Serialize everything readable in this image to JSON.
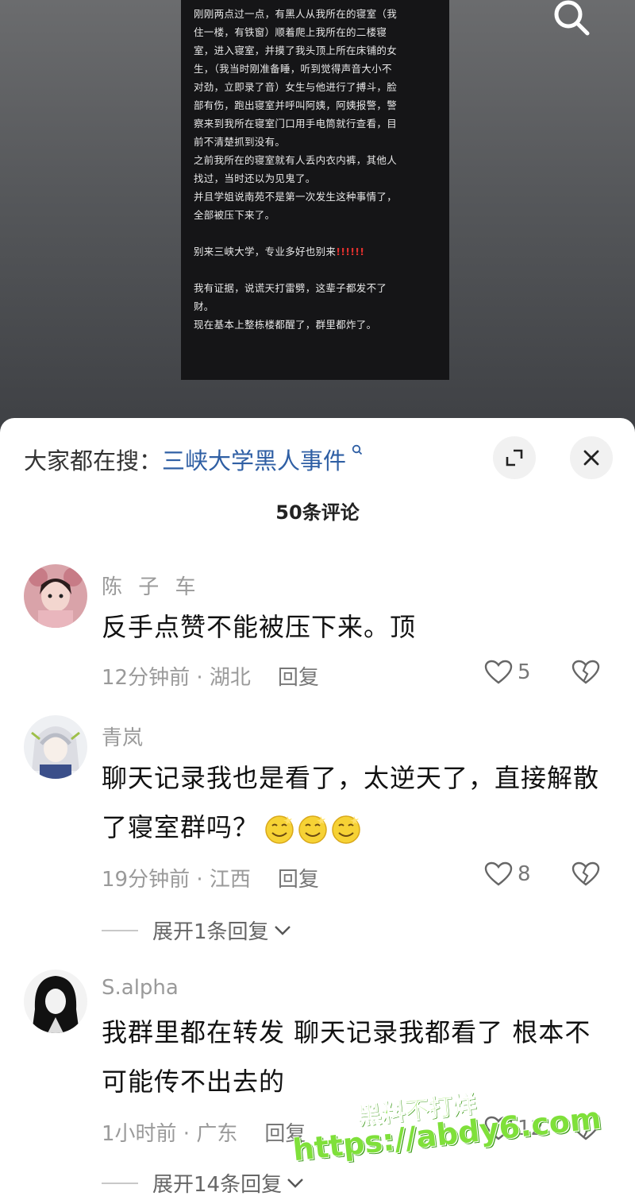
{
  "note": {
    "lines": [
      "刚刚两点过一点，有黑人从我所在的寝室（我",
      "住一楼，有铁窗）顺着爬上我所在的二楼寝",
      "室，进入寝室，并摸了我头顶上所在床铺的女",
      "生，（我当时刚准备睡，听到觉得声音大小不",
      "对劲，立即录了音）女生与他进行了搏斗，脸",
      "部有伤，跑出寝室并呼叫阿姨，阿姨报警，警",
      "察来到我所在寝室门口用手电筒就行查看，目",
      "前不清楚抓到没有。",
      "之前我所在的寝室就有人丢内衣内裤，其他人",
      "找过，当时还以为见鬼了。",
      "并且学姐说南苑不是第一次发生这种事情了，",
      "全部被压下来了。"
    ],
    "warning_text": "别来三峡大学，专业多好也别来",
    "warning_marks": "!!!!!!",
    "closing_lines": [
      "我有证据，说谎天打雷劈，这辈子都发不了",
      "财。",
      "现在基本上整栋楼都醒了，群里都炸了。"
    ]
  },
  "header": {
    "hot_search_prefix": "大家都在搜：",
    "hot_search_topic": "三峡大学黑人事件",
    "expand_icon": "expand-icon",
    "close_icon": "close-icon"
  },
  "comment_count": "50条评论",
  "comments": [
    {
      "username": "陈 子 车",
      "text": "反手点赞不能被压下来。顶",
      "time_location": "12分钟前 · 湖北",
      "reply_label": "回复",
      "likes": "5"
    },
    {
      "username": "青岚",
      "text": "聊天记录我也是看了，太逆天了，直接解散了寝室群吗？",
      "time_location": "19分钟前 · 江西",
      "reply_label": "回复",
      "likes": "8",
      "expand_label": "展开1条回复"
    },
    {
      "username": "S.alpha",
      "text": "我群里都在转发 聊天记录我都看了 根本不可能传不出去的",
      "time_location": "1小时前 · 广东",
      "reply_label": "回复",
      "likes": "12",
      "expand_label": "展开14条回复"
    }
  ],
  "watermark": {
    "line1": "黑料不打烊",
    "line2": "https://abdy6.com"
  },
  "colors": {
    "topic_link": "#2f5fa4",
    "watermark": "#7fe03a"
  }
}
